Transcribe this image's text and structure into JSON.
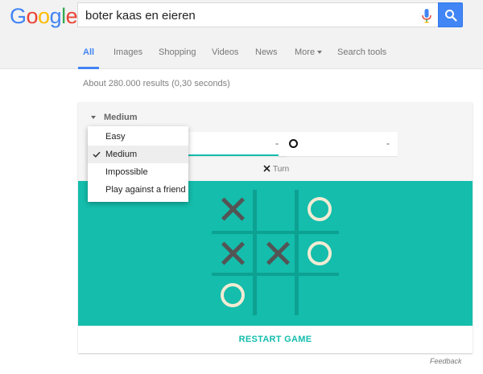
{
  "logo": {
    "letters": [
      "G",
      "o",
      "o",
      "g",
      "l",
      "e"
    ],
    "colors": [
      "#4285f4",
      "#ea4335",
      "#fbbc05",
      "#4285f4",
      "#34a853",
      "#ea4335"
    ]
  },
  "search": {
    "query": "boter kaas en eieren",
    "icon": "search-icon",
    "mic_icon": "microphone-icon"
  },
  "tabs": [
    {
      "label": "All",
      "active": true
    },
    {
      "label": "Images"
    },
    {
      "label": "Shopping"
    },
    {
      "label": "Videos"
    },
    {
      "label": "News"
    },
    {
      "label": "More"
    },
    {
      "label": "Search tools"
    }
  ],
  "result_stats": "About 280.000 results (0,30 seconds)",
  "game": {
    "difficulty_label": "Medium",
    "difficulty_options": [
      {
        "label": "Easy"
      },
      {
        "label": "Medium",
        "selected": true
      },
      {
        "label": "Impossible"
      },
      {
        "label": "Play against a friend"
      }
    ],
    "players": {
      "x": {
        "score": "-"
      },
      "o": {
        "score": "-"
      }
    },
    "turn_label": "Turn",
    "board": [
      "X",
      "",
      "O",
      "X",
      "X",
      "O",
      "O",
      "",
      ""
    ],
    "colors": {
      "board": "#14bdac",
      "grid": "#0da192",
      "x": "#545454",
      "o": "#f2ebd3"
    },
    "restart_label": "RESTART GAME"
  },
  "feedback_label": "Feedback"
}
